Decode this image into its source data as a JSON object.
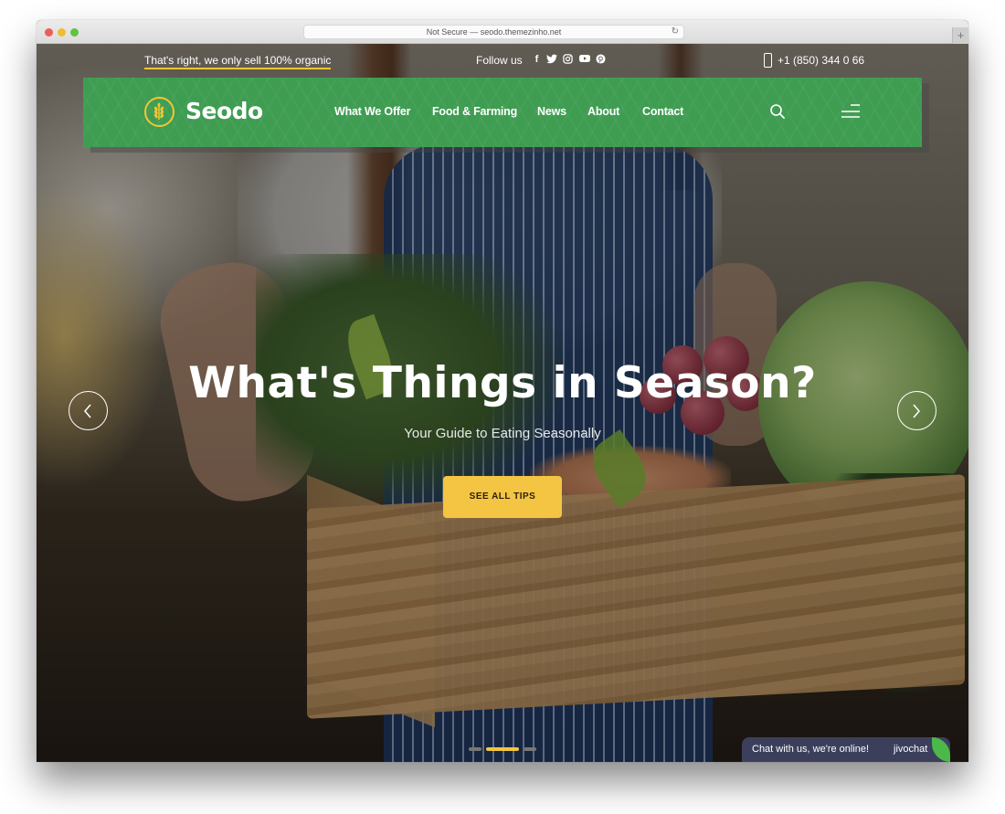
{
  "browser": {
    "url_text": "Not Secure — seodo.themezinho.net",
    "reload_icon": "reload-icon",
    "new_tab_label": "+"
  },
  "topbar": {
    "tagline": "That's right, we only sell 100% organic",
    "follow_label": "Follow us",
    "social": [
      {
        "name": "facebook",
        "glyph": "f"
      },
      {
        "name": "twitter",
        "glyph": "t"
      },
      {
        "name": "instagram",
        "glyph": "◎"
      },
      {
        "name": "youtube",
        "glyph": "▶"
      },
      {
        "name": "pinterest",
        "glyph": "p"
      }
    ],
    "phone": "+1 (850) 344 0 66"
  },
  "nav": {
    "brand": "Seodo",
    "items": [
      {
        "label": "What We Offer"
      },
      {
        "label": "Food & Farming"
      },
      {
        "label": "News"
      },
      {
        "label": "About"
      },
      {
        "label": "Contact"
      }
    ]
  },
  "hero": {
    "headline": "What's Things in Season?",
    "subtitle": "Your Guide to Eating Seasonally",
    "cta": "SEE ALL TIPS",
    "slides_total": 3,
    "active_slide": 2
  },
  "chat": {
    "text": "Chat with us, we're online!",
    "brand": "jivochat"
  },
  "colors": {
    "brand_green": "#3f9d52",
    "accent_yellow": "#f3c542",
    "chat_bg": "#3c3f5c"
  }
}
